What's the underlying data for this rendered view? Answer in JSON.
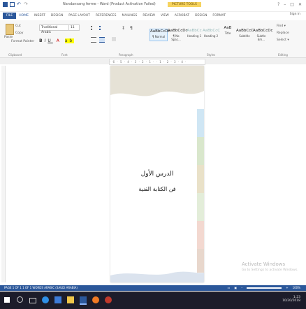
{
  "window": {
    "title": "Nandansang ferme - Word (Product Activation Failed)",
    "tools_tab": "PICTURE TOOLS",
    "sign_in": "Sign in",
    "controls": [
      "?",
      "–",
      "□",
      "✕"
    ]
  },
  "ribbon_tabs": [
    "FILE",
    "HOME",
    "INSERT",
    "DESIGN",
    "PAGE LAYOUT",
    "REFERENCES",
    "MAILINGS",
    "REVIEW",
    "VIEW",
    "ACROBAT",
    "DESIGN",
    "FORMAT"
  ],
  "ribbon": {
    "clipboard": {
      "paste_label": "Paste",
      "cut": "Cut",
      "copy": "Copy",
      "format_painter": "Format Painter"
    },
    "font": {
      "font_name": "Traditional Arabic",
      "font_size": "11"
    },
    "styles": [
      {
        "preview": "AaBbCcDc",
        "name": "¶ Normal"
      },
      {
        "preview": "AaBbCcDc",
        "name": "¶ No Spac..."
      },
      {
        "preview": "AaBbCc",
        "name": "Heading 1"
      },
      {
        "preview": "AaBbCcC",
        "name": "Heading 2"
      },
      {
        "preview": "AaB",
        "name": "Title"
      },
      {
        "preview": "AaBbCcC",
        "name": "Subtitle"
      },
      {
        "preview": "AaBbCcDc",
        "name": "Subtle Em..."
      }
    ],
    "editing": {
      "find": "Find ▾",
      "replace": "Replace",
      "select": "Select ▾"
    },
    "group_labels": {
      "clipboard": "Clipboard",
      "font": "Font",
      "paragraph": "Paragraph",
      "styles": "Styles",
      "editing": "Editing"
    }
  },
  "ruler_text": "· 6 · 5 · 4 · 3 · 2 · 1 · · 1 · 2 · 3 · 4 ·",
  "document": {
    "title": "الدرس الأول",
    "subtitle": "فن الكتابة الفنية"
  },
  "watermark": {
    "line1": "Activate Windows",
    "line2": "Go to Settings to activate Windows."
  },
  "statusbar": {
    "left": "PAGE 1 OF 1   1 OF 1 WORDS   ARABIC (SAUDI ARABIA)",
    "zoom": "100%"
  },
  "taskbar": {
    "time": "1:23",
    "date": "10/20/2018"
  },
  "colors": {
    "accent": "#2b579a",
    "page_stripes": [
      "#e8d7cc",
      "#cfe6f4",
      "#d9e7cc",
      "#e9e1c8",
      "#e3edd9",
      "#f3d8d0",
      "#dbe5ef"
    ]
  }
}
